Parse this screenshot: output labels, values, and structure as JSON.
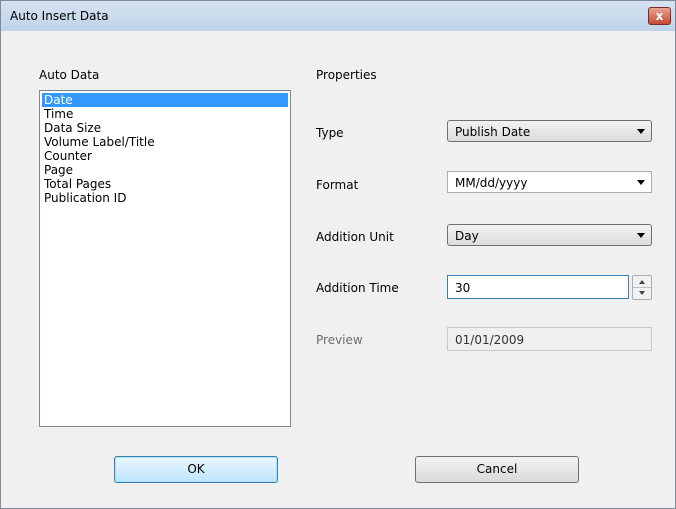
{
  "window": {
    "title": "Auto Insert Data",
    "close_glyph": "x"
  },
  "auto_data": {
    "label": "Auto Data",
    "items": [
      {
        "label": "Date",
        "selected": true
      },
      {
        "label": "Time"
      },
      {
        "label": "Data Size"
      },
      {
        "label": "Volume Label/Title"
      },
      {
        "label": "Counter"
      },
      {
        "label": "Page"
      },
      {
        "label": "Total Pages"
      },
      {
        "label": "Publication ID"
      }
    ]
  },
  "properties": {
    "label": "Properties",
    "type": {
      "label": "Type",
      "value": "Publish Date"
    },
    "format": {
      "label": "Format",
      "value": "MM/dd/yyyy"
    },
    "addition_unit": {
      "label": "Addition Unit",
      "value": "Day"
    },
    "addition_time": {
      "label": "Addition Time",
      "value": "30"
    },
    "preview": {
      "label": "Preview",
      "value": "01/01/2009"
    }
  },
  "buttons": {
    "ok": "OK",
    "cancel": "Cancel"
  },
  "colors": {
    "selection": "#3399ff",
    "title_gradient_top": "#d6e3f1",
    "close_button": "#c74b35"
  }
}
